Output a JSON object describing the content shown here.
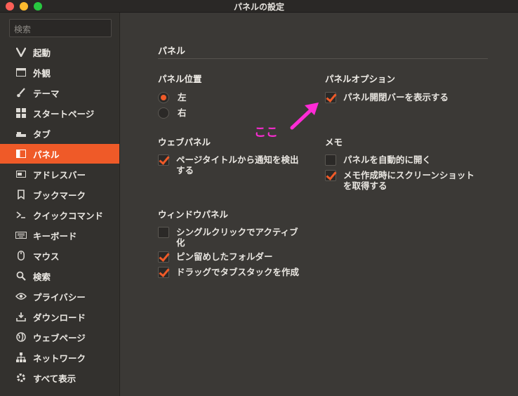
{
  "window": {
    "title": "パネルの設定"
  },
  "sidebar": {
    "search_placeholder": "検索",
    "items": [
      {
        "label": "起動",
        "icon": "vivaldi-icon"
      },
      {
        "label": "外観",
        "icon": "window-icon"
      },
      {
        "label": "テーマ",
        "icon": "brush-icon"
      },
      {
        "label": "スタートページ",
        "icon": "grid-icon"
      },
      {
        "label": "タブ",
        "icon": "tab-icon"
      },
      {
        "label": "パネル",
        "icon": "panel-icon",
        "active": true
      },
      {
        "label": "アドレスバー",
        "icon": "address-bar-icon"
      },
      {
        "label": "ブックマーク",
        "icon": "bookmark-icon"
      },
      {
        "label": "クイックコマンド",
        "icon": "prompt-icon"
      },
      {
        "label": "キーボード",
        "icon": "keyboard-icon"
      },
      {
        "label": "マウス",
        "icon": "mouse-icon"
      },
      {
        "label": "検索",
        "icon": "search-icon"
      },
      {
        "label": "プライバシー",
        "icon": "eye-icon"
      },
      {
        "label": "ダウンロード",
        "icon": "download-icon"
      },
      {
        "label": "ウェブページ",
        "icon": "globe-icon"
      },
      {
        "label": "ネットワーク",
        "icon": "network-icon"
      },
      {
        "label": "すべて表示",
        "icon": "gear-icon"
      }
    ]
  },
  "main": {
    "section_title": "パネル",
    "panel_position": {
      "heading": "パネル位置",
      "options": [
        {
          "label": "左",
          "checked": true
        },
        {
          "label": "右",
          "checked": false
        }
      ]
    },
    "panel_options": {
      "heading": "パネルオプション",
      "show_toggle_bar": {
        "label": "パネル開閉バーを表示する",
        "checked": true
      }
    },
    "web_panels": {
      "heading": "ウェブパネル",
      "detect_notifications": {
        "label": "ページタイトルから通知を検出する",
        "checked": true
      }
    },
    "notes": {
      "heading": "メモ",
      "open_auto": {
        "label": "パネルを自動的に開く",
        "checked": false
      },
      "screenshot": {
        "label": "メモ作成時にスクリーンショットを取得する",
        "checked": true
      }
    },
    "window_panel": {
      "heading": "ウィンドウパネル",
      "single_click": {
        "label": "シングルクリックでアクティブ化",
        "checked": false
      },
      "pinned_folders": {
        "label": "ピン留めしたフォルダー",
        "checked": true
      },
      "drag_stack": {
        "label": "ドラッグでタブスタックを作成",
        "checked": true
      }
    }
  },
  "annotation": {
    "text": "ここ",
    "color": "#ff2bd6"
  },
  "colors": {
    "accent": "#ef5a28",
    "background": "#3b3936",
    "sidebar": "#33312e"
  }
}
